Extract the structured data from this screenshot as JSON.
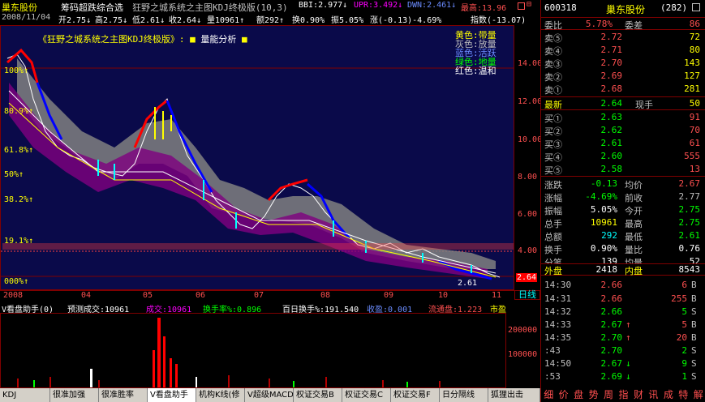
{
  "title_bar": {
    "stock_name": "巢东股份",
    "menu_1": "筹码超跌综合选",
    "indicator_title": "狂野之城系统之主图KDJ终极版(10,3)",
    "bbi": "BBI:2.977↓",
    "upr": "UPR:3.492↓",
    "dwn": "DWN:2.461↓",
    "high_lbl": "最高:13.96"
  },
  "info_bar": {
    "date": "2008/11/04",
    "open": "开2.75↓",
    "high": "高2.75↓",
    "low": "低2.61↓",
    "close": "收2.64↓",
    "vol": "量10961↑",
    "amt": "额292↑",
    "turnover": "换0.90%",
    "amp": "振5.05%",
    "chg": "涨(-0.13)-4.69%",
    "idx": "指数(-13.07)"
  },
  "chart": {
    "legend_title": "《狂野之城系统之主图KDJ终极版》:",
    "legend_vol": "量能分析",
    "color_legend": [
      "黄色:带量",
      "灰色:放量",
      "蓝色:活跃",
      "绿色:地量",
      "红色:温和"
    ],
    "fib": [
      "100%↑",
      "80.9%↑",
      "61.8%↑",
      "50%↑",
      "38.2%↑",
      "19.1%↑",
      "000%↑"
    ],
    "price_ticks": [
      "14.00",
      "12.00",
      "10.00",
      "8.00",
      "6.00",
      "4.00"
    ],
    "price_tag": "2.64",
    "low_lbl": "2.61",
    "months": [
      "2008",
      "04",
      "05",
      "06",
      "07",
      "08",
      "09",
      "10",
      "11"
    ],
    "period": "日线"
  },
  "vol": {
    "header": [
      "V看盘助手(0)",
      "预测成交:10961",
      "成交:10961",
      "换手率%:0.896",
      "百日换手%:191.540",
      "收盈:0.001",
      "流通盘:1.223",
      "市盈"
    ],
    "ticks": [
      "200000",
      "100000"
    ]
  },
  "tabs": [
    "KDJ",
    "很准加强",
    "很准胜率",
    "V看盘助手",
    "机构K线(修",
    "V超级MACD",
    "权证交易B",
    "权证交易C",
    "权证交易F",
    "日分隔线",
    "狐狸出击"
  ],
  "rp": {
    "code": "600318",
    "name": "巢东股份",
    "tot": "(282)",
    "wb_lbl": "委比",
    "wb": "5.78%",
    "wc_lbl": "委差",
    "wc": "86",
    "sells": [
      [
        "卖⑤",
        "2.72",
        "72"
      ],
      [
        "卖④",
        "2.71",
        "80"
      ],
      [
        "卖③",
        "2.70",
        "143"
      ],
      [
        "卖②",
        "2.69",
        "127"
      ],
      [
        "卖①",
        "2.68",
        "281"
      ]
    ],
    "latest_lbl": "最新",
    "latest": "2.64",
    "now_lbl": "现手",
    "now": "50",
    "buys": [
      [
        "买①",
        "2.63",
        "91"
      ],
      [
        "买②",
        "2.62",
        "70"
      ],
      [
        "买③",
        "2.61",
        "61"
      ],
      [
        "买④",
        "2.60",
        "555"
      ],
      [
        "买⑤",
        "2.58",
        "13"
      ]
    ],
    "stats": [
      [
        "涨跌",
        "-0.13",
        "均价",
        "2.67"
      ],
      [
        "涨幅",
        "-4.69%",
        "前收",
        "2.77"
      ],
      [
        "振幅",
        "5.05%",
        "今开",
        "2.75"
      ],
      [
        "总手",
        "10961",
        "最高",
        "2.75"
      ],
      [
        "总额",
        "292",
        "最低",
        "2.61"
      ],
      [
        "换手",
        "0.90%",
        "量比",
        "0.76"
      ],
      [
        "分笔",
        "139",
        "均量",
        "52"
      ]
    ],
    "outer_lbl": "外盘",
    "outer": "2418",
    "inner_lbl": "内盘",
    "inner": "8543",
    "ticks": [
      [
        "14:30",
        "2.66",
        "",
        "6",
        "B"
      ],
      [
        "14:31",
        "2.66",
        "",
        "255",
        "B"
      ],
      [
        "14:32",
        "2.66",
        "",
        "5",
        "S"
      ],
      [
        "14:33",
        "2.67",
        "↑",
        "5",
        "B"
      ],
      [
        "14:35",
        "2.70",
        "↑",
        "20",
        "B"
      ],
      [
        ":43",
        "2.70",
        "",
        "2",
        "S"
      ],
      [
        "14:50",
        "2.67",
        "↓",
        "9",
        "S"
      ],
      [
        ":53",
        "2.69",
        "↓",
        "1",
        "S"
      ]
    ],
    "bottom_tabs": [
      "细",
      "价",
      "盘",
      "势",
      "周",
      "指",
      "财",
      "讯",
      "成",
      "特",
      "解"
    ]
  }
}
